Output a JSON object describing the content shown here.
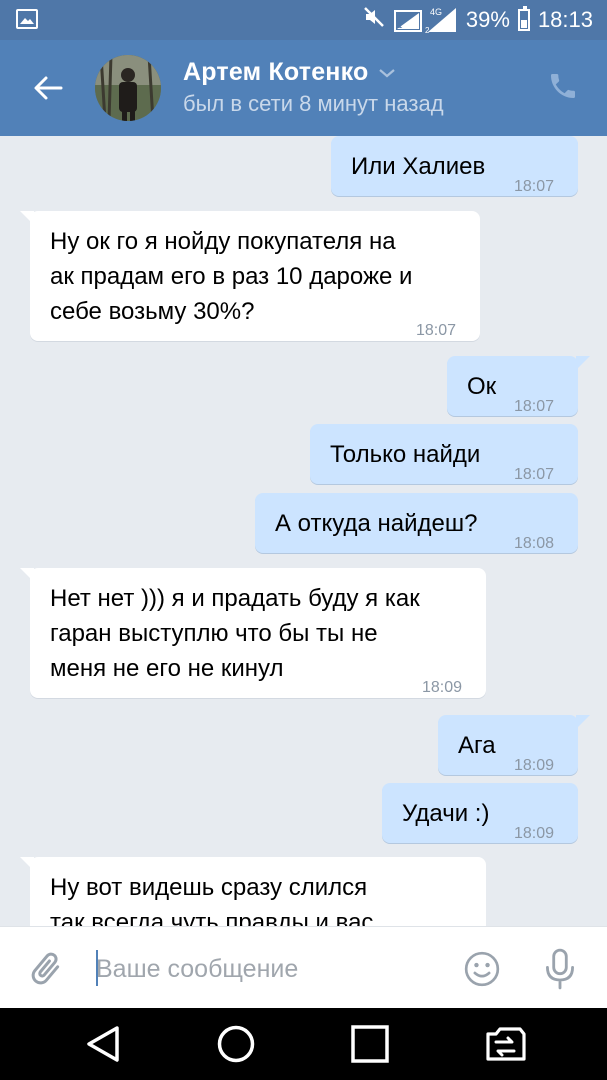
{
  "status_bar": {
    "network": "4G",
    "sim1": "1",
    "sim2": "2",
    "battery": "39%",
    "time": "18:13"
  },
  "header": {
    "contact_name": "Артем Котенко",
    "contact_status": "был в сети 8 минут назад"
  },
  "messages": [
    {
      "direction": "out",
      "text": "Или Халиев",
      "time": "18:07"
    },
    {
      "direction": "in",
      "text": "Ну ок го я нойду покупателя на\nак прадам его в раз 10 дароже и\nсебе возьму 30%?",
      "time": "18:07"
    },
    {
      "direction": "out",
      "text": "Ок",
      "time": "18:07"
    },
    {
      "direction": "out",
      "text": "Только найди",
      "time": "18:07"
    },
    {
      "direction": "out",
      "text": "А откуда найдеш?",
      "time": "18:08"
    },
    {
      "direction": "in",
      "text": "Нет нет ))) я и прадать буду я как\nгаран выступлю что бы ты не\nменя не его не кинул",
      "time": "18:09"
    },
    {
      "direction": "out",
      "text": "Ага",
      "time": "18:09"
    },
    {
      "direction": "out",
      "text": "Удачи :)",
      "time": "18:09"
    },
    {
      "direction": "in",
      "text": "Ну вот видешь сразу слился\nтак всегда чуть правды и вас",
      "time": ""
    }
  ],
  "input": {
    "placeholder": "Ваше сообщение",
    "value": ""
  },
  "icons": {
    "status": [
      "gallery-icon",
      "mute-icon",
      "signal-icon",
      "battery-icon"
    ],
    "header": [
      "back-arrow-icon",
      "chevron-down-icon",
      "phone-icon"
    ],
    "input": [
      "paperclip-icon",
      "emoji-icon",
      "microphone-icon"
    ],
    "nav": [
      "back-triangle-icon",
      "home-circle-icon",
      "recents-square-icon",
      "switch-sim-icon"
    ]
  },
  "colors": {
    "header": "#5181b8",
    "status_bar": "#4f77a8",
    "chat_background": "#e7ebf0",
    "incoming_bubble": "#ffffff",
    "outgoing_bubble": "#cce4ff"
  }
}
